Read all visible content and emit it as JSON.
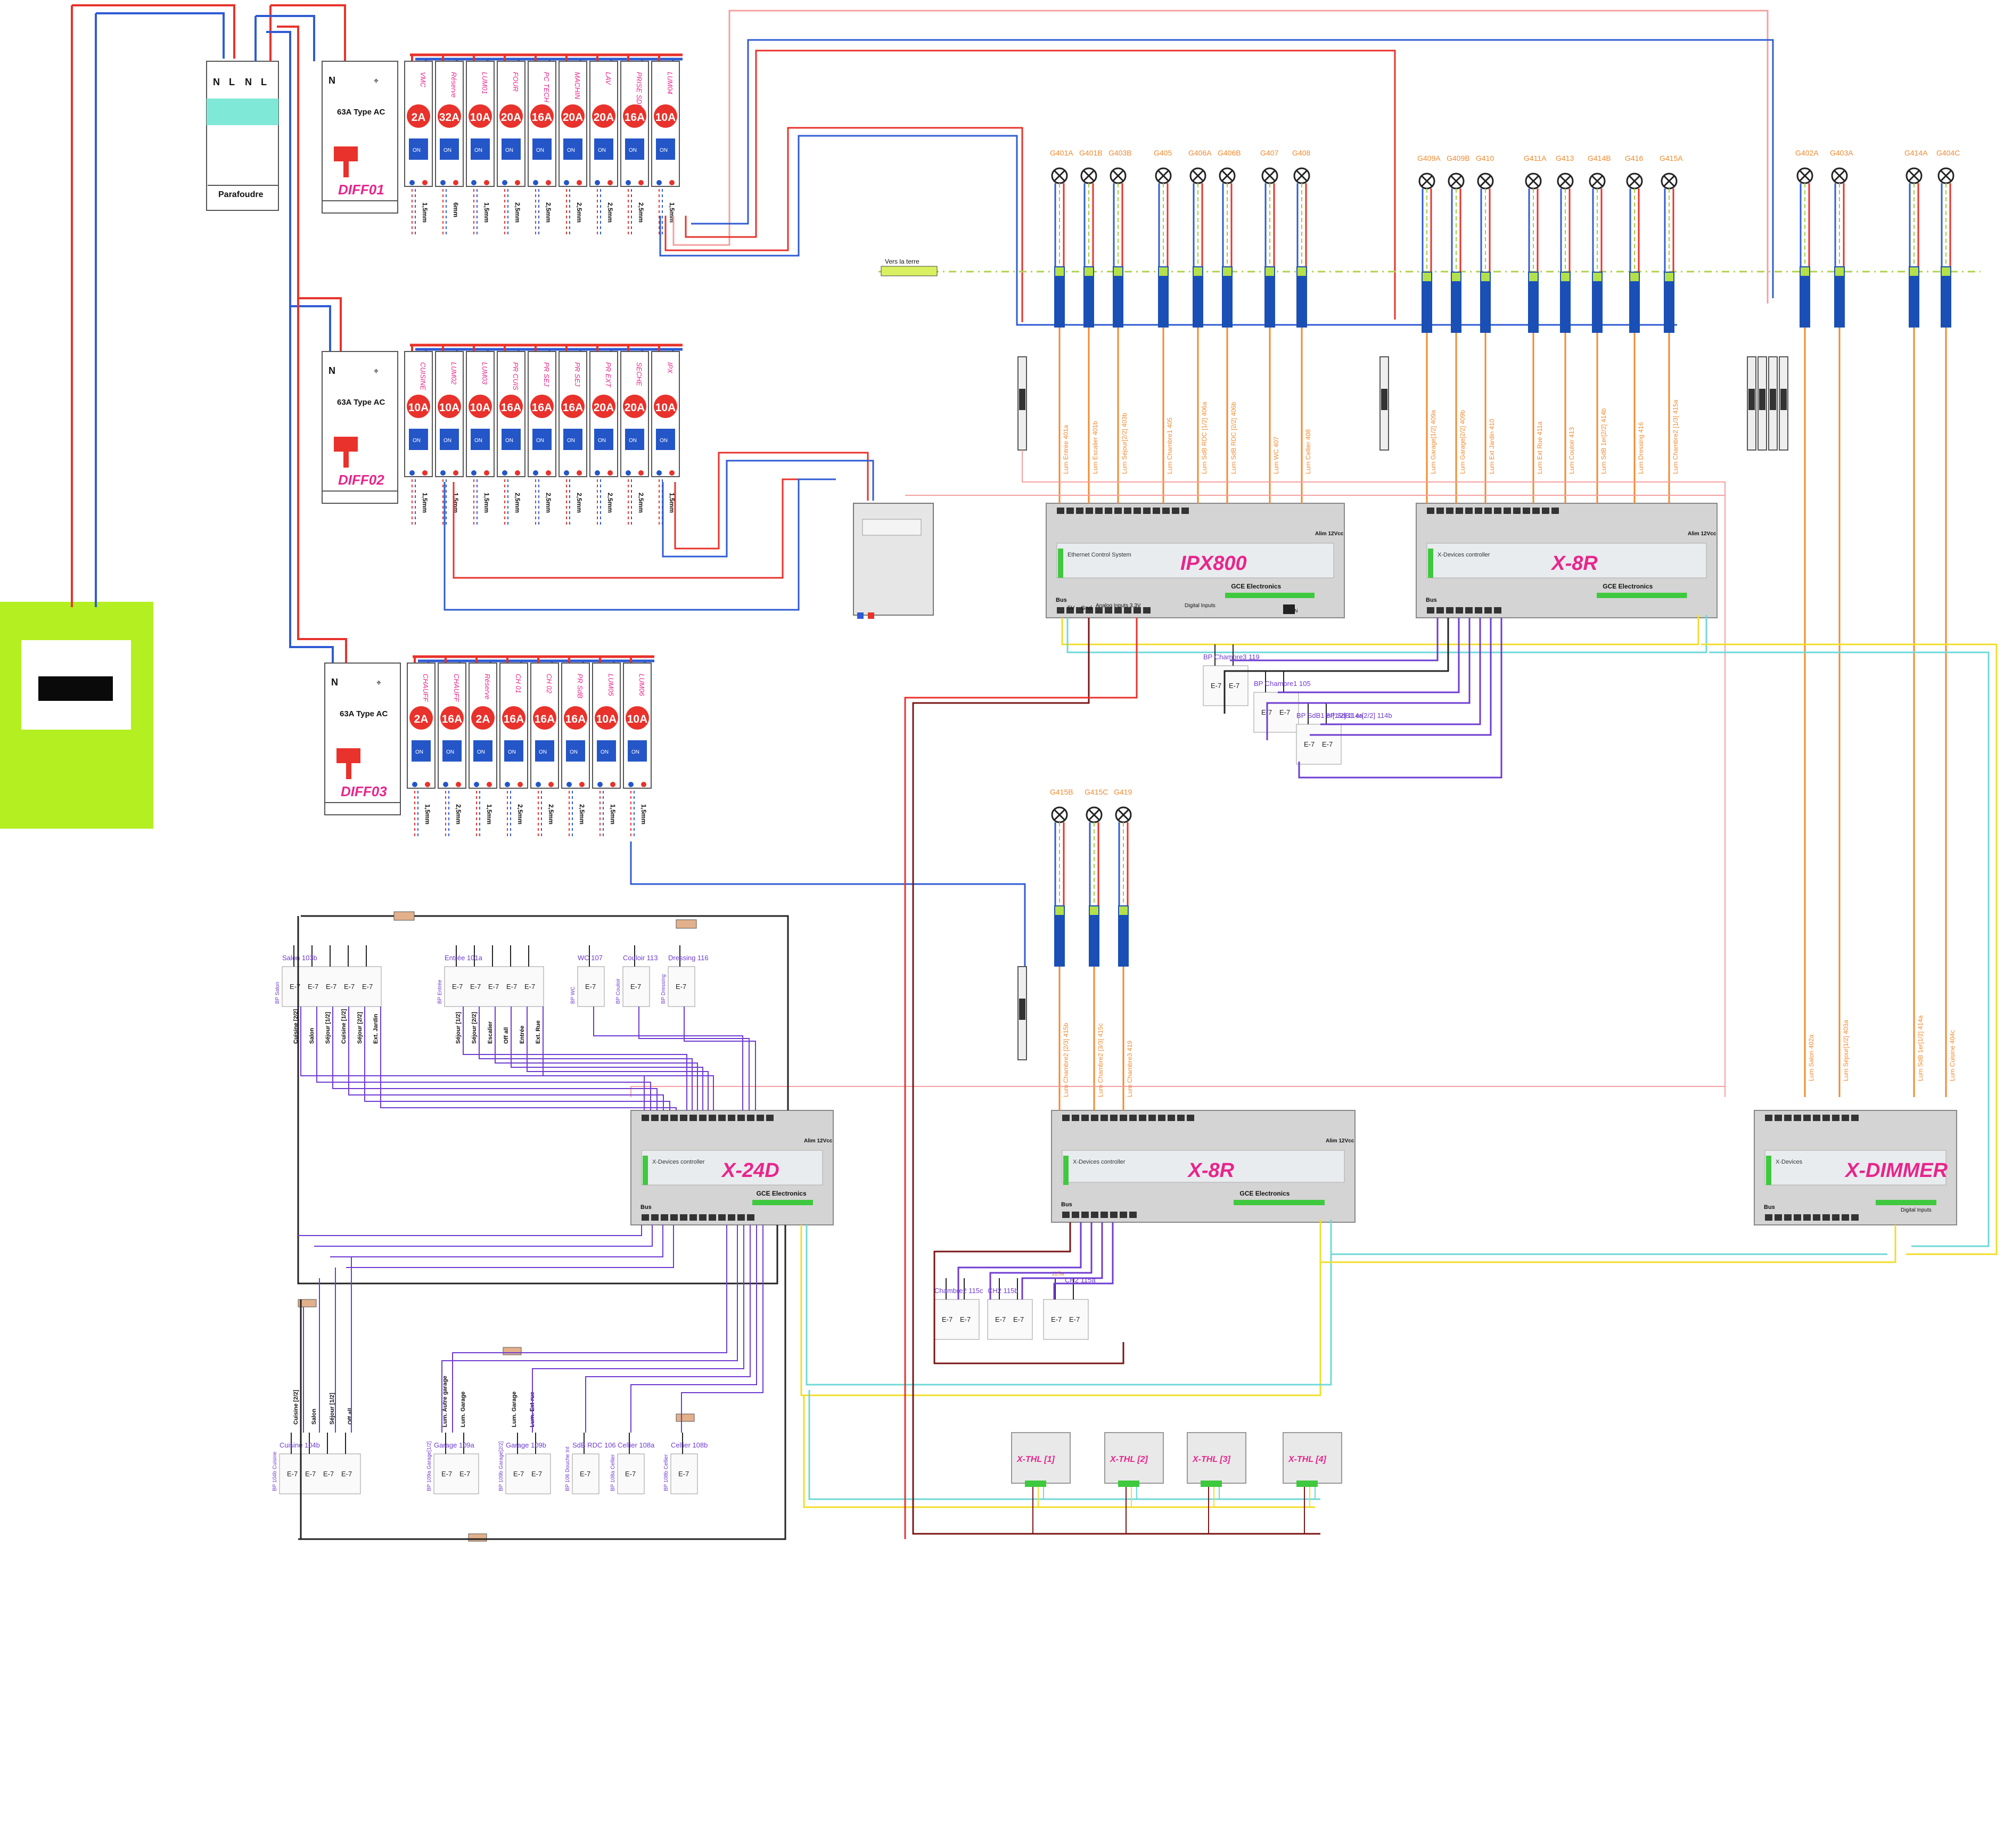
{
  "meter": {
    "name": "meter"
  },
  "surge": {
    "label": "Parafoudre",
    "terms": [
      "N",
      "L",
      "N",
      "L"
    ]
  },
  "panels": [
    {
      "name": "DIFF01",
      "type": "63A Type AC",
      "n": "N",
      "breakers": [
        {
          "label": "VMC",
          "rating": "2A",
          "sec": "1,5mm"
        },
        {
          "label": "Réserve",
          "rating": "32A",
          "sec": "6mm"
        },
        {
          "label": "LUM01",
          "rating": "10A",
          "sec": "1,5mm"
        },
        {
          "label": "FOUR",
          "rating": "20A",
          "sec": "2,5mm"
        },
        {
          "label": "PC TECH",
          "rating": "16A",
          "sec": "2,5mm"
        },
        {
          "label": "MACHIN",
          "rating": "20A",
          "sec": "2,5mm"
        },
        {
          "label": "LAV",
          "rating": "20A",
          "sec": "2,5mm"
        },
        {
          "label": "PRISE SDB",
          "rating": "16A",
          "sec": "2,5mm"
        },
        {
          "label": "LUM04",
          "rating": "10A",
          "sec": "1,5mm"
        }
      ]
    },
    {
      "name": "DIFF02",
      "type": "63A Type AC",
      "n": "N",
      "breakers": [
        {
          "label": "CUISINE",
          "rating": "10A",
          "sec": "1,5mm"
        },
        {
          "label": "LUM02",
          "rating": "10A",
          "sec": "1,5mm"
        },
        {
          "label": "LUM03",
          "rating": "10A",
          "sec": "1,5mm"
        },
        {
          "label": "PR CUIS",
          "rating": "16A",
          "sec": "2,5mm"
        },
        {
          "label": "PR SEJ",
          "rating": "16A",
          "sec": "2,5mm"
        },
        {
          "label": "PR SEJ",
          "rating": "16A",
          "sec": "2,5mm"
        },
        {
          "label": "PR EXT",
          "rating": "20A",
          "sec": "2,5mm"
        },
        {
          "label": "SECHE",
          "rating": "20A",
          "sec": "2,5mm"
        },
        {
          "label": "IPX",
          "rating": "10A",
          "sec": "1,5mm"
        }
      ]
    },
    {
      "name": "DIFF03",
      "type": "63A Type AC",
      "n": "N",
      "breakers": [
        {
          "label": "CHAUFF",
          "rating": "2A",
          "sec": "1,5mm"
        },
        {
          "label": "CHAUFF",
          "rating": "16A",
          "sec": "2,5mm"
        },
        {
          "label": "Réserve",
          "rating": "2A",
          "sec": "1,5mm"
        },
        {
          "label": "CH 01",
          "rating": "16A",
          "sec": "2,5mm"
        },
        {
          "label": "CH 02",
          "rating": "16A",
          "sec": "2,5mm"
        },
        {
          "label": "PR SdB",
          "rating": "16A",
          "sec": "2,5mm"
        },
        {
          "label": "LUM05",
          "rating": "10A",
          "sec": "1,5mm"
        },
        {
          "label": "LUM06",
          "rating": "10A",
          "sec": "1,5mm"
        }
      ]
    }
  ],
  "earth": {
    "label": "Vers la terre"
  },
  "lamps_top_a": [
    {
      "id": "G401A",
      "cable": "Lum Entrée  401a"
    },
    {
      "id": "G401B",
      "cable": "Lum Escalier  401b"
    },
    {
      "id": "G403B",
      "cable": "Lum Séjour[2/2]  403b"
    },
    {
      "id": "G405",
      "cable": "Lum Chambre1  405"
    },
    {
      "id": "G406A",
      "cable": "Lum SdB RDC [1/2]  406a"
    },
    {
      "id": "G406B",
      "cable": "Lum SdB RDC [2/2]  406b"
    },
    {
      "id": "G407",
      "cable": "Lum WC  407"
    },
    {
      "id": "G408",
      "cable": "Lum Cellier  408"
    }
  ],
  "lamps_top_b": [
    {
      "id": "G409A",
      "cable": "Lum Garage[1/2]  409a"
    },
    {
      "id": "G409B",
      "cable": "Lum Garage[2/2]  409b"
    },
    {
      "id": "G410",
      "cable": "Lum Ext Jardin  410"
    },
    {
      "id": "G411A",
      "cable": "Lum Ext Rue  411a"
    },
    {
      "id": "G413",
      "cable": "Lum Couloir  413"
    },
    {
      "id": "G414B",
      "cable": "Lum SdB 1er[2/2]  414b"
    },
    {
      "id": "G416",
      "cable": "Lum Dressing  416"
    },
    {
      "id": "G415A",
      "cable": "Lum Chambre2 [1/3]  415a"
    }
  ],
  "lamps_dimmer": [
    {
      "id": "G402A",
      "cable": "Lum Salon  402a"
    },
    {
      "id": "G403A",
      "cable": "Lum Séjour[1/2]  403a"
    },
    {
      "id": "G414A",
      "cable": "Lum SdB 1er[1/2]  414a"
    },
    {
      "id": "G404C",
      "cable": "Lum Cuisine  404c"
    }
  ],
  "lamps_mid": [
    {
      "id": "G415B",
      "cable": "Lum Chambre2 [2/3]  415b"
    },
    {
      "id": "G415C",
      "cable": "Lum Chambre2 [3/3]  415c"
    },
    {
      "id": "G419",
      "cable": "Lum Chambre3  419"
    }
  ],
  "modules": {
    "ipx": {
      "title": "IPX800",
      "sub": "Ethernet Control System",
      "brand": "GCE Electronics",
      "lbl_bus": "Bus",
      "lbl_5v": "5V",
      "lbl_gnd": "Gnd",
      "lbl_analog": "Analog Inputs   3.3V",
      "lbl_digital": "Digital Inputs",
      "lbl_alim": "Alim 12Vcc",
      "lbl_lan": "LAN"
    },
    "x8r_a": {
      "title": "X-8R",
      "sub": "X-Devices controller",
      "brand": "GCE Electronics",
      "lbl_bus": "Bus",
      "lbl_alim": "Alim 12Vcc"
    },
    "x8r_b": {
      "title": "X-8R",
      "sub": "X-Devices controller",
      "brand": "GCE Electronics",
      "lbl_bus": "Bus",
      "lbl_alim": "Alim 12Vcc"
    },
    "x24d": {
      "title": "X-24D",
      "sub": "X-Devices controller",
      "brand": "GCE Electronics",
      "lbl_bus": "Bus",
      "lbl_alim": "Alim 12Vcc"
    },
    "xdim": {
      "title": "X-DIMMER",
      "sub": "X-Devices",
      "lbl_bus": "Bus",
      "lbl_digital": "Digital Inputs"
    }
  },
  "thl": [
    {
      "label": "X-THL [1]"
    },
    {
      "label": "X-THL [2]"
    },
    {
      "label": "X-THL [3]"
    },
    {
      "label": "X-THL [4]"
    }
  ],
  "bp_top": [
    {
      "title": "BP Chambre3   119"
    },
    {
      "title": "BP Chambre1   105"
    },
    {
      "title": "BP SdB1 er[1/2]   114a"
    },
    {
      "title": "BP SdB1 er[2/2]   114b"
    }
  ],
  "bp_x24_top": [
    {
      "title": "Salon   103b",
      "tag": "BP Salon",
      "cables": [
        "Cuisine [2/2]",
        "Salon",
        "Séjour [1/2]",
        "Cuisine [1/2]",
        "Séjour [2/2]",
        "Ext. Jardin"
      ]
    },
    {
      "title": "Entrée   101a",
      "tag": "BP Entrée",
      "cables": [
        "Séjour [1/2]",
        "Séjour [2/2]",
        "Escalier",
        "Off all",
        "Entrée",
        "Ext. Rue"
      ]
    },
    {
      "title": "WC   107",
      "tag": "BP WC"
    },
    {
      "title": "Couloir 113",
      "tag": "BP Couloir"
    },
    {
      "title": "Dressing   116",
      "tag": "BP Dressing"
    }
  ],
  "bp_x24_bottom": [
    {
      "title": "Cuisine 104b",
      "tag": "BP 104b Cuisine",
      "cables": [
        "Cuisine [2/2]",
        "Salon",
        "Séjour [1/2]",
        "Off all"
      ]
    },
    {
      "title": "Garage 109a",
      "tag": "BP 109a Garage[1/2]",
      "cables": [
        "Lum. Autre garage",
        "Lum. Garage"
      ]
    },
    {
      "title": "Garage 109b",
      "tag": "BP 109b Garage[2/2]",
      "cables": [
        "Lum. Garage",
        "Lum. Ext rue"
      ]
    },
    {
      "title": "SdB RDC  106",
      "tag": "BP 106 Douche Int"
    },
    {
      "title": "Cellier  108a",
      "tag": "BP 108a Cellier"
    },
    {
      "title": "Cellier  108b",
      "tag": "BP 108b Cellier"
    }
  ],
  "bp_x8r_b": [
    {
      "title": "Chambre2   115c"
    },
    {
      "title": "CH2 115b"
    },
    {
      "title": "CH2  115a"
    }
  ]
}
